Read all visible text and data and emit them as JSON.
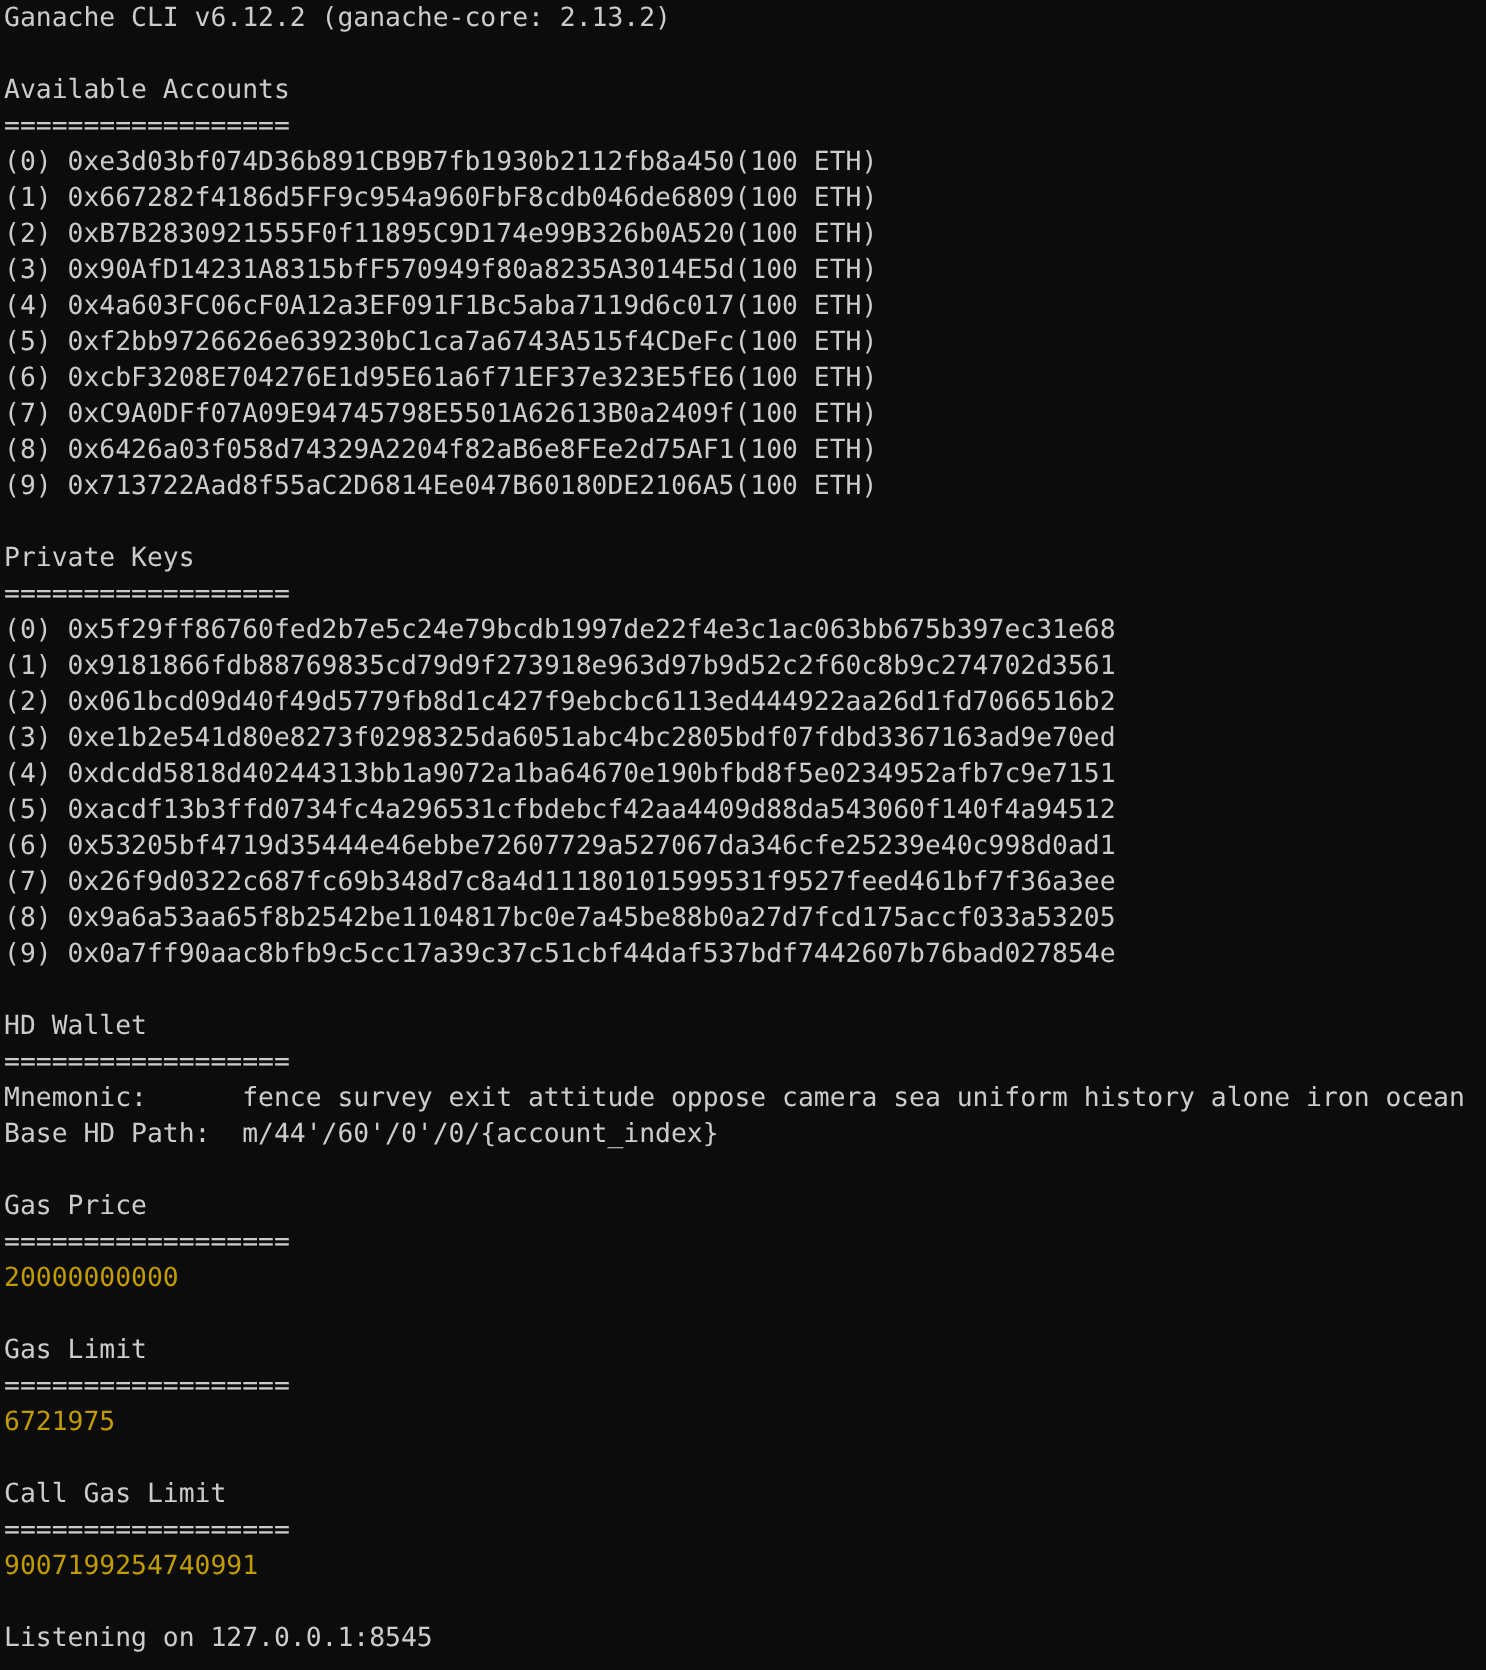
{
  "header": "Ganache CLI v6.12.2 (ganache-core: 2.13.2)",
  "sections": [
    {
      "kind": "list",
      "title": "Available Accounts",
      "rule": "==================",
      "items": [
        {
          "index": "(0)",
          "address": "0xe3d03bf074D36b891CB9B7fb1930b2112fb8a450",
          "balance": "(100 ETH)"
        },
        {
          "index": "(1)",
          "address": "0x667282f4186d5FF9c954a960FbF8cdb046de6809",
          "balance": "(100 ETH)"
        },
        {
          "index": "(2)",
          "address": "0xB7B2830921555F0f11895C9D174e99B326b0A520",
          "balance": "(100 ETH)"
        },
        {
          "index": "(3)",
          "address": "0x90AfD14231A8315bfF570949f80a8235A3014E5d",
          "balance": "(100 ETH)"
        },
        {
          "index": "(4)",
          "address": "0x4a603FC06cF0A12a3EF091F1Bc5aba7119d6c017",
          "balance": "(100 ETH)"
        },
        {
          "index": "(5)",
          "address": "0xf2bb9726626e639230bC1ca7a6743A515f4CDeFc",
          "balance": "(100 ETH)"
        },
        {
          "index": "(6)",
          "address": "0xcbF3208E704276E1d95E61a6f71EF37e323E5fE6",
          "balance": "(100 ETH)"
        },
        {
          "index": "(7)",
          "address": "0xC9A0DFf07A09E94745798E5501A62613B0a2409f",
          "balance": "(100 ETH)"
        },
        {
          "index": "(8)",
          "address": "0x6426a03f058d74329A2204f82aB6e8FEe2d75AF1",
          "balance": "(100 ETH)"
        },
        {
          "index": "(9)",
          "address": "0x713722Aad8f55aC2D6814Ee047B60180DE2106A5",
          "balance": "(100 ETH)"
        }
      ]
    },
    {
      "kind": "list",
      "title": "Private Keys",
      "rule": "==================",
      "items": [
        {
          "index": "(0)",
          "address": "0x5f29ff86760fed2b7e5c24e79bcdb1997de22f4e3c1ac063bb675b397ec31e68"
        },
        {
          "index": "(1)",
          "address": "0x9181866fdb88769835cd79d9f273918e963d97b9d52c2f60c8b9c274702d3561"
        },
        {
          "index": "(2)",
          "address": "0x061bcd09d40f49d5779fb8d1c427f9ebcbc6113ed444922aa26d1fd7066516b2"
        },
        {
          "index": "(3)",
          "address": "0xe1b2e541d80e8273f0298325da6051abc4bc2805bdf07fdbd3367163ad9e70ed"
        },
        {
          "index": "(4)",
          "address": "0xdcdd5818d40244313bb1a9072a1ba64670e190bfbd8f5e0234952afb7c9e7151"
        },
        {
          "index": "(5)",
          "address": "0xacdf13b3ffd0734fc4a296531cfbdebcf42aa4409d88da543060f140f4a94512"
        },
        {
          "index": "(6)",
          "address": "0x53205bf4719d35444e46ebbe72607729a527067da346cfe25239e40c998d0ad1"
        },
        {
          "index": "(7)",
          "address": "0x26f9d0322c687fc69b348d7c8a4d11180101599531f9527feed461bf7f36a3ee"
        },
        {
          "index": "(8)",
          "address": "0x9a6a53aa65f8b2542be1104817bc0e7a45be88b0a27d7fcd175accf033a53205"
        },
        {
          "index": "(9)",
          "address": "0x0a7ff90aac8bfb9c5cc17a39c37c51cbf44daf537bdf7442607b76bad027854e"
        }
      ]
    },
    {
      "kind": "fields",
      "title": "HD Wallet",
      "rule": "==================",
      "fields": [
        {
          "label": "Mnemonic:",
          "value": "fence survey exit attitude oppose camera sea uniform history alone iron ocean"
        },
        {
          "label": "Base HD Path:",
          "value": "m/44'/60'/0'/0/{account_index}"
        }
      ]
    },
    {
      "kind": "value",
      "title": "Gas Price",
      "rule": "==================",
      "value": "20000000000"
    },
    {
      "kind": "value",
      "title": "Gas Limit",
      "rule": "==================",
      "value": "6721975"
    },
    {
      "kind": "value",
      "title": "Call Gas Limit",
      "rule": "==================",
      "value": "9007199254740991"
    }
  ],
  "footer": "Listening on 127.0.0.1:8545"
}
